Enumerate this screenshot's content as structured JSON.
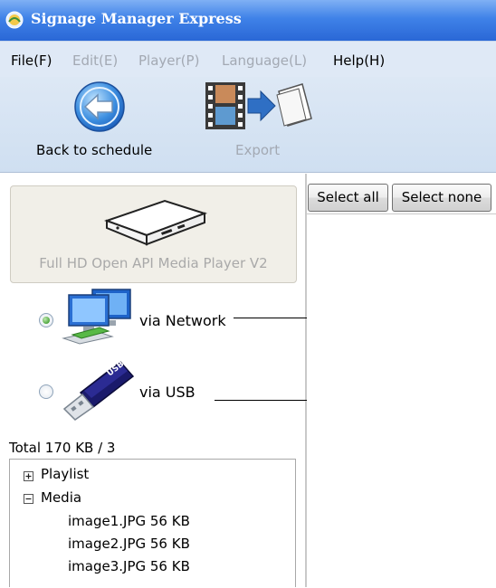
{
  "window": {
    "title": "Signage Manager Express"
  },
  "menu": [
    {
      "label": "File(F)",
      "enabled": true
    },
    {
      "label": "Edit(E)",
      "enabled": false
    },
    {
      "label": "Player(P)",
      "enabled": false
    },
    {
      "label": "Language(L)",
      "enabled": false
    },
    {
      "label": "Help(H)",
      "enabled": true
    }
  ],
  "toolbar": {
    "back_label": "Back to schedule",
    "export_label": "Export"
  },
  "device": {
    "name": "Full HD Open API Media Player V2"
  },
  "connection": {
    "network_label": "via Network",
    "usb_label": "via USB",
    "selected": "network"
  },
  "summary": {
    "total": "Total 170 KB / 3"
  },
  "tree": {
    "playlist_label": "Playlist",
    "media_label": "Media",
    "media_items": [
      "image1.JPG 56 KB",
      "image2.JPG 56 KB",
      "image3.JPG 56 KB"
    ]
  },
  "selection": {
    "select_all_label": "Select all",
    "select_none_label": "Select none"
  }
}
